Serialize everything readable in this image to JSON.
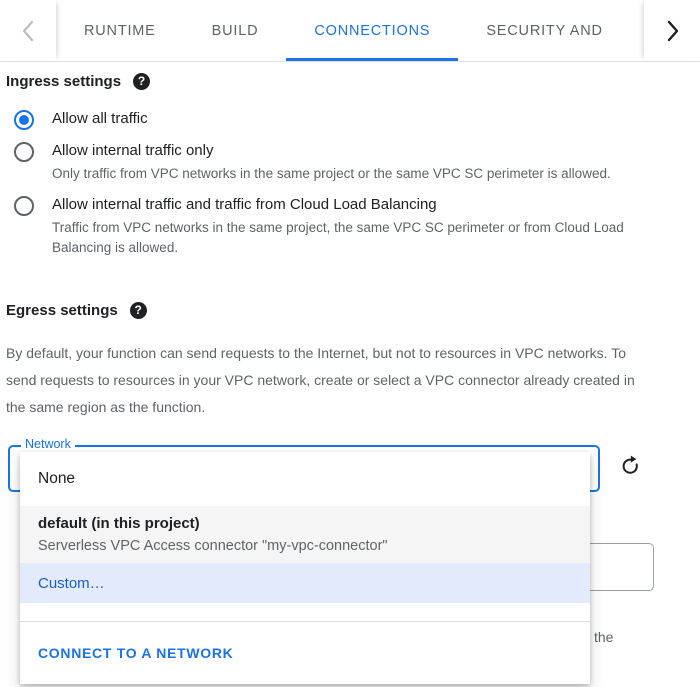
{
  "tabbar": {
    "prev_icon": "chevron-left-icon",
    "next_icon": "chevron-right-icon",
    "tabs": [
      {
        "label": "RUNTIME",
        "active": false
      },
      {
        "label": "BUILD",
        "active": false
      },
      {
        "label": "CONNECTIONS",
        "active": true
      },
      {
        "label": "SECURITY AND",
        "active": false
      }
    ]
  },
  "ingress": {
    "title": "Ingress settings",
    "help_icon": "help-icon",
    "options": [
      {
        "label": "Allow all traffic",
        "description": "",
        "selected": true
      },
      {
        "label": "Allow internal traffic only",
        "description": "Only traffic from VPC networks in the same project or the same VPC SC perimeter is allowed.",
        "selected": false
      },
      {
        "label": "Allow internal traffic and traffic from Cloud Load Balancing",
        "description": "Traffic from VPC networks in the same project, the same VPC SC perimeter or from Cloud Load Balancing is allowed.",
        "selected": false
      }
    ]
  },
  "egress": {
    "title": "Egress settings",
    "help_icon": "help-icon",
    "description": "By default, your function can send requests to the Internet, but not to resources in VPC networks. To send requests to resources in your VPC network, create or select a VPC connector already created in the same region as the function.",
    "network_field": {
      "label": "Network",
      "value": "",
      "refresh_icon": "refresh-icon"
    },
    "tail_text": "the"
  },
  "dropdown": {
    "items": [
      {
        "label": "None",
        "sublabel": "",
        "state": "normal"
      },
      {
        "label": "default (in this project)",
        "sublabel": "Serverless VPC Access connector \"my-vpc-connector\"",
        "state": "hovered"
      },
      {
        "label": "Custom…",
        "sublabel": "",
        "state": "highlighted"
      }
    ],
    "action": {
      "label": "CONNECT TO A NETWORK"
    }
  },
  "colors": {
    "accent": "#1a73e8",
    "text_primary": "#202124",
    "text_secondary": "#5f6368",
    "highlight_bg": "#e3eafc",
    "hover_bg": "#f5f5f5"
  }
}
